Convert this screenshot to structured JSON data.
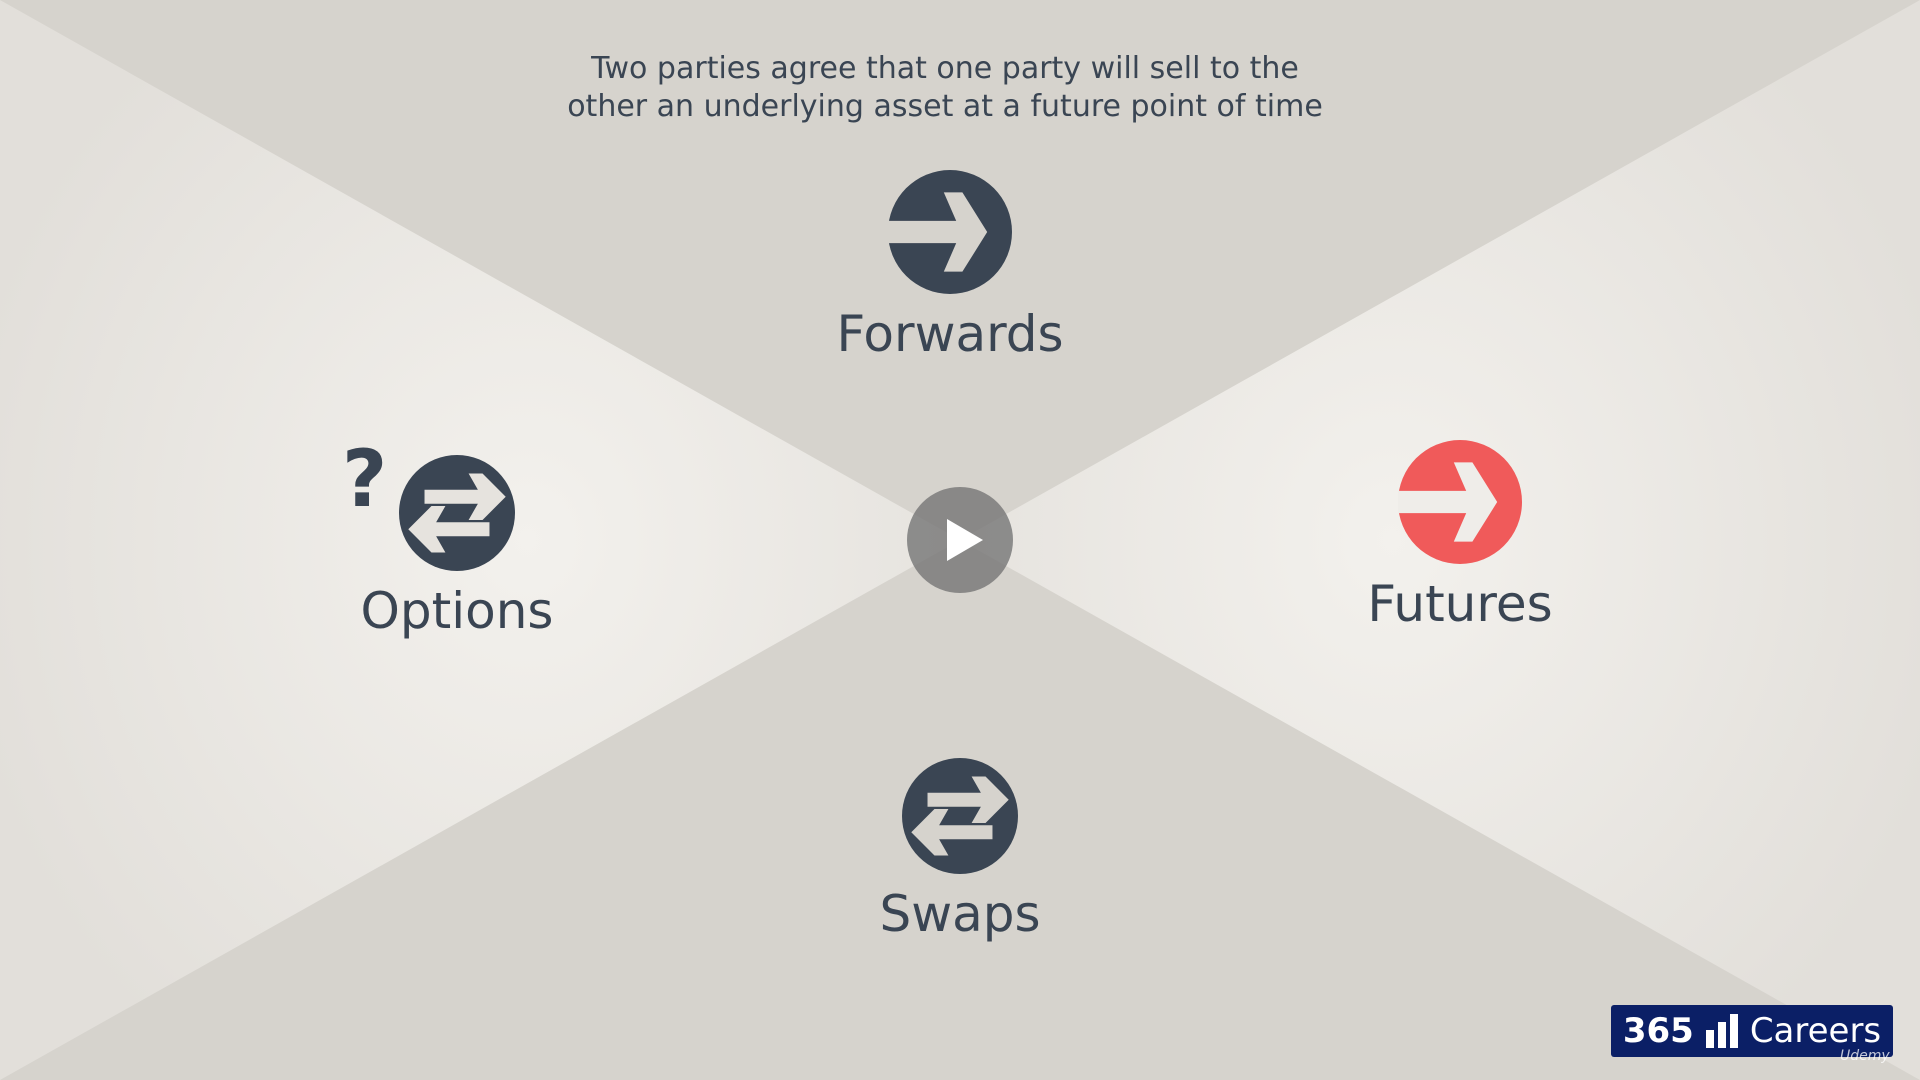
{
  "slide": {
    "caption_lines": [
      "Two parties agree that one party will sell to the",
      "other an underlying asset at a future point of time"
    ],
    "items": {
      "forwards": {
        "label": "Forwards",
        "icon": "arrow-right-circle-icon",
        "color": "#3a4553"
      },
      "futures": {
        "label": "Futures",
        "icon": "arrow-right-circle-icon",
        "color": "#f05a5a"
      },
      "swaps": {
        "label": "Swaps",
        "icon": "swap-arrows-circle-icon",
        "color": "#3a4553"
      },
      "options": {
        "label": "Options",
        "icon": "swap-arrows-circle-icon",
        "color": "#3a4553",
        "badge": "?"
      }
    }
  },
  "player": {
    "play_icon": "play-icon"
  },
  "branding": {
    "logo_number": "365",
    "logo_word": "Careers",
    "watermark": "Udemy"
  },
  "colors": {
    "background_light": "#f1efeb",
    "background_dark": "#d6d3cd",
    "text": "#3a4553",
    "accent": "#f05a5a",
    "logo_bg": "#0b1f66"
  }
}
